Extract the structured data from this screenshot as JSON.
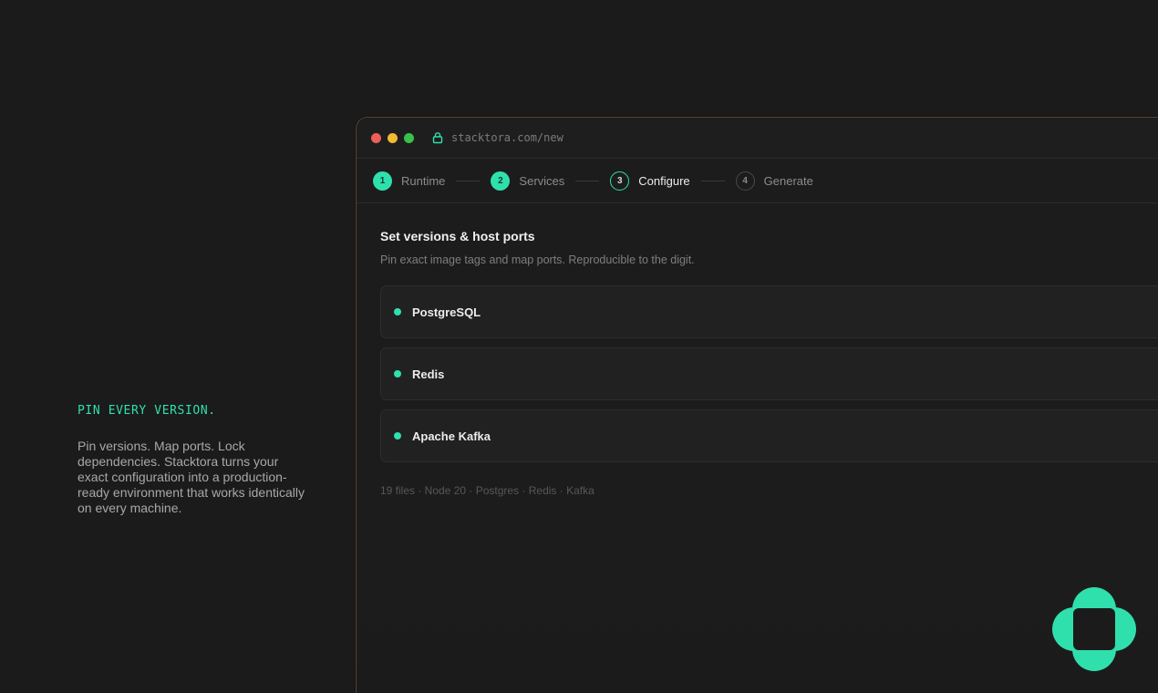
{
  "hero": {
    "eyebrow": "PIN EVERY VERSION.",
    "body": "Pin versions. Map ports. Lock dependencies. Stacktora turns your exact configuration into a production-ready environment that works identically on every machine."
  },
  "browser": {
    "url": "stacktora.com/new"
  },
  "wizard": {
    "steps": [
      {
        "number": "1",
        "label": "Runtime",
        "state": "done"
      },
      {
        "number": "2",
        "label": "Services",
        "state": "done"
      },
      {
        "number": "3",
        "label": "Configure",
        "state": "active"
      },
      {
        "number": "4",
        "label": "Generate",
        "state": "todo"
      }
    ]
  },
  "configure": {
    "title": "Set versions & host ports",
    "subtitle": "Pin exact image tags and map ports. Reproducible to the digit.",
    "services": [
      {
        "name": "PostgreSQL"
      },
      {
        "name": "Redis"
      },
      {
        "name": "Apache Kafka"
      }
    ],
    "summary": "19 files · Node 20 · Postgres · Redis · Kafka"
  },
  "colors": {
    "accent": "#2fe0ad",
    "background": "#1b1b1b"
  }
}
